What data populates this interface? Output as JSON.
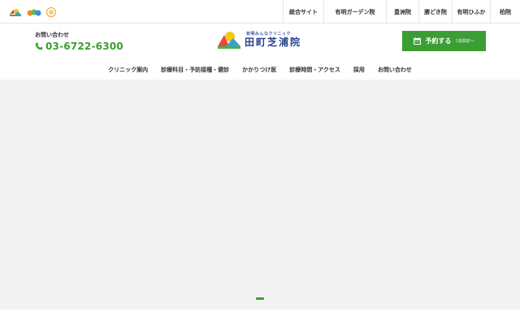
{
  "top_bar": {
    "mini_logos": [
      "group-logo-icon",
      "kids-logo-icon",
      "sub-logo-icon"
    ],
    "sites": [
      {
        "label": "総合サイト"
      },
      {
        "label": "有明ガーデン院"
      },
      {
        "label": "豊洲院"
      },
      {
        "label": "勝どき院"
      },
      {
        "label": "有明ひふか"
      },
      {
        "label": "柏院"
      }
    ]
  },
  "header": {
    "contact_label": "お問い合わせ",
    "phone_icon": "phone-icon",
    "phone_number": "03-6722-6300",
    "brand_sub": "有明みんなクリニック",
    "brand_name": "田町芝浦院",
    "reserve_icon": "calendar-icon",
    "reserve_label": "予約する",
    "reserve_note": "1週間前～"
  },
  "nav": {
    "items": [
      {
        "label": "クリニック案内"
      },
      {
        "label": "診療科目・予防接種・健診"
      },
      {
        "label": "かかりつけ医"
      },
      {
        "label": "診療時間・アクセス"
      },
      {
        "label": "採用"
      },
      {
        "label": "お問い合わせ"
      }
    ]
  },
  "hero": {
    "slide_count": 1,
    "active_slide": 1
  },
  "colors": {
    "accent_green": "#3b9e35",
    "brand_navy": "#233e8b",
    "hero_bg": "#f2f2f2"
  }
}
